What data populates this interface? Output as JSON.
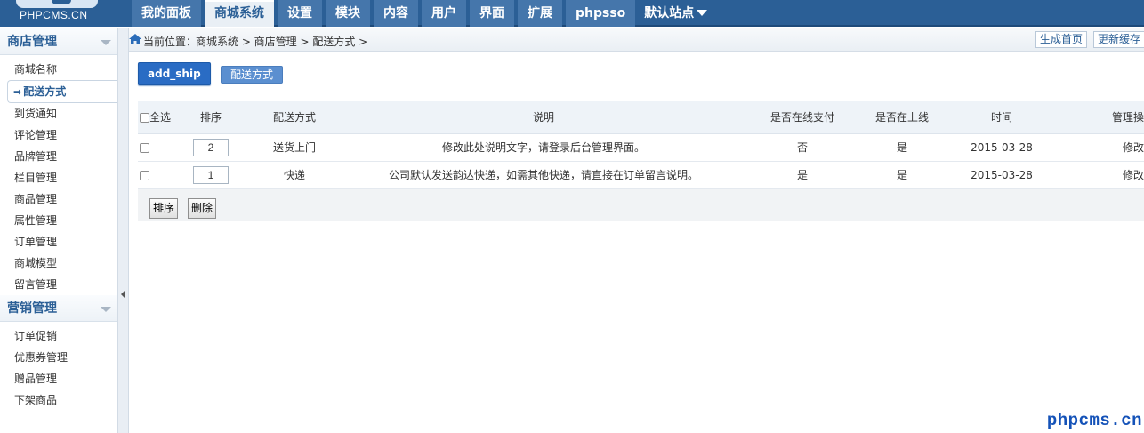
{
  "logo": {
    "text": "PHPCMS.CN"
  },
  "nav": [
    {
      "label": "我的面板",
      "active": false
    },
    {
      "label": "商城系统",
      "active": true
    },
    {
      "label": "设置",
      "active": false
    },
    {
      "label": "模块",
      "active": false
    },
    {
      "label": "内容",
      "active": false
    },
    {
      "label": "用户",
      "active": false
    },
    {
      "label": "界面",
      "active": false
    },
    {
      "label": "扩展",
      "active": false
    },
    {
      "label": "phpsso",
      "active": false
    }
  ],
  "site_menu": {
    "label": "默认站点"
  },
  "sidebar": {
    "group1": {
      "title": "商店管理",
      "items": [
        "商城名称",
        "配送方式",
        "到货通知",
        "评论管理",
        "品牌管理",
        "栏目管理",
        "商品管理",
        "属性管理",
        "订单管理",
        "商城模型",
        "留言管理"
      ],
      "active_index": 1
    },
    "group2": {
      "title": "营销管理",
      "items": [
        "订单促销",
        "优惠券管理",
        "赠品管理",
        "下架商品"
      ]
    }
  },
  "breadcrumb": {
    "label": "当前位置：",
    "path": "商城系统 > 商店管理 > 配送方式 >"
  },
  "top_actions": {
    "gen_home": "生成首页",
    "update_cache": "更新缓存"
  },
  "toolbar": {
    "add_ship": "add_ship",
    "ship_method": "配送方式"
  },
  "table": {
    "headers": {
      "select_all": "全选",
      "order": "排序",
      "method": "配送方式",
      "desc": "说明",
      "online_pay": "是否在线支付",
      "online": "是否在上线",
      "time": "时间",
      "manage": "管理操"
    },
    "rows": [
      {
        "order": "2",
        "method": "送货上门",
        "desc": "修改此处说明文字，请登录后台管理界面。",
        "online_pay": "否",
        "online": "是",
        "time": "2015-03-28",
        "manage": "修改"
      },
      {
        "order": "1",
        "method": "快递",
        "desc": "公司默认发送韵达快递，如需其他快递，请直接在订单留言说明。",
        "online_pay": "是",
        "online": "是",
        "time": "2015-03-28",
        "manage": "修改"
      }
    ]
  },
  "footer_buttons": {
    "sort": "排序",
    "delete": "删除"
  },
  "watermark": "phpcms.cn",
  "colors": {
    "topbar": "#2b5f96",
    "primary_button": "#2a6cc4",
    "link": "#2b5f96"
  }
}
